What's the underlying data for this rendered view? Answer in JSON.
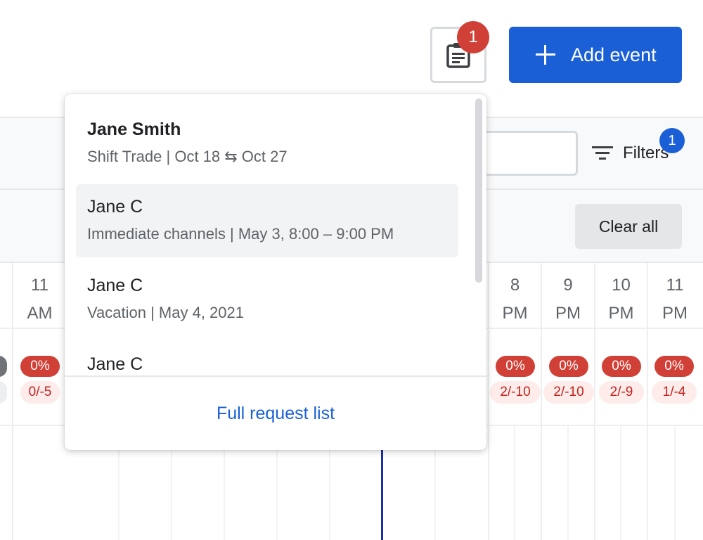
{
  "header": {
    "requests_badge": "1",
    "add_event_label": "Add event"
  },
  "toolbar": {
    "filters_label": "Filters",
    "filters_badge": "1",
    "clear_all_label": "Clear all"
  },
  "schedule": {
    "hours": [
      {
        "label": "11\nAM",
        "pct": "0%",
        "ratio": "0/-5"
      },
      {
        "label": "8\nPM",
        "pct": "0%",
        "ratio": "2/-10"
      },
      {
        "label": "9\nPM",
        "pct": "0%",
        "ratio": "2/-10"
      },
      {
        "label": "10\nPM",
        "pct": "0%",
        "ratio": "2/-9"
      },
      {
        "label": "11\nPM",
        "pct": "0%",
        "ratio": "1/-4"
      }
    ]
  },
  "requests_popover": {
    "items": [
      {
        "name": "Jane Smith",
        "detail": "Shift Trade | Oct 18 ⇆ Oct 27"
      },
      {
        "name": "Jane C",
        "detail": "Immediate channels | May 3, 8:00 – 9:00 PM"
      },
      {
        "name": "Jane C",
        "detail": "Vacation | May 4, 2021"
      },
      {
        "name": "Jane C",
        "detail": ""
      }
    ],
    "full_list_label": "Full request list"
  },
  "colors": {
    "accent": "#1a5fd6",
    "alert": "#d14036",
    "alert_bg": "#fdecea",
    "now_line": "#1a2fa8"
  }
}
